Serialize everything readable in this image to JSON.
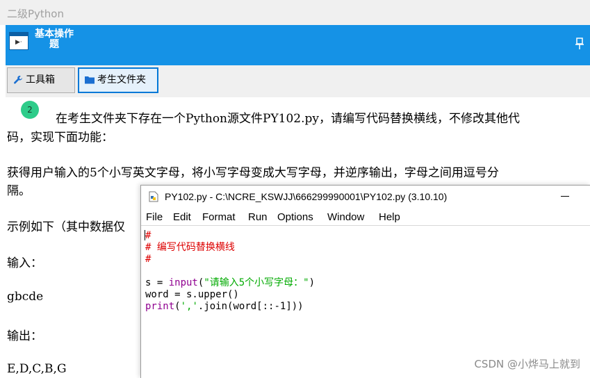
{
  "window": {
    "title": "二级Python"
  },
  "header": {
    "title": "基本操作题"
  },
  "toolbar": {
    "toolbox_label": "工具箱",
    "folder_label": "考生文件夹"
  },
  "question": {
    "number": "2",
    "lines": [
      "在考生文件夹下存在一个Python源文件PY102.py，请编写代码替换横线，不修改其他代",
      "码，实现下面功能：",
      "获得用户输入的5个小写英文字母，将小写字母变成大写字母，并逆序输出，字母之间用逗号分",
      "隔。",
      "示例如下（其中数据仅",
      "输入：",
      "gbcde",
      "输出：",
      "E,D,C,B,G"
    ]
  },
  "idle": {
    "title": "PY102.py - C:\\NCRE_KSWJJ\\666299990001\\PY102.py (3.10.10)",
    "menu": [
      "File",
      "Edit",
      "Format",
      "Run",
      "Options",
      "Window",
      "Help"
    ],
    "code": {
      "c1": "#",
      "c2": "# 编写代码替换横线",
      "c3": "#",
      "l1_a": "s = ",
      "l1_fn": "input",
      "l1_b": "(",
      "l1_str": "\"请输入5个小写字母：\"",
      "l1_c": ")",
      "l2": "word = s.upper()",
      "l3_fn": "print",
      "l3_a": "(",
      "l3_str": "','",
      "l3_b": ".join(word[::-1]))"
    }
  },
  "watermark": "CSDN @小烨马上就到",
  "colors": {
    "header": "#1592e6",
    "comment": "#dd0000",
    "builtin": "#900090",
    "string": "#00aa00",
    "badge": "#2ecc8a"
  }
}
